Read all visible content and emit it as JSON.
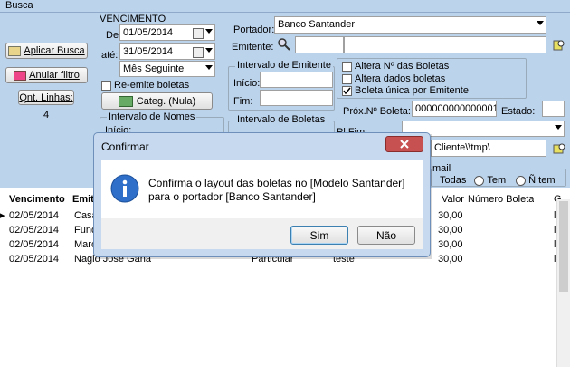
{
  "busca": {
    "title": "Busca"
  },
  "left": {
    "aplicar": "Aplicar Busca",
    "anular": "Anular filtro",
    "qnt_label": "Qnt. Linhas:",
    "qnt_value": "4"
  },
  "vencimento": {
    "title": "VENCIMENTO",
    "de_label": "De:",
    "de_value": "01/05/2014",
    "ate_label": "até:",
    "ate_value": "31/05/2014",
    "period": "Mês Seguinte",
    "reemite": "Re-emite boletas",
    "categ": "Categ. (Nula)",
    "nomes_group": "Intervalo de Nomes",
    "inicio_label": "Início:"
  },
  "portador": {
    "label": "Portador:",
    "value": "Banco Santander",
    "emitente_label": "Emitente:"
  },
  "intervalo_emitente": {
    "title": "Intervalo de Emitente",
    "inicio": "Início:",
    "fim": "Fim:"
  },
  "options": {
    "altera_num": "Altera Nº das Boletas",
    "altera_dados": "Altera dados boletas",
    "boleta_unica": "Boleta única por Emitente"
  },
  "intervalo_boletas": {
    "title": "Intervalo de Boletas"
  },
  "prox": {
    "label": "Próx.Nº Boleta:",
    "value": "000000000000001",
    "estado_label": "Estado:",
    "estado_value": ""
  },
  "pl_fim": "Pl.Fim:",
  "path": {
    "value": "Cliente\\\\tmp\\"
  },
  "email": {
    "title": "mail",
    "todas": "Todas",
    "tem": "Tem",
    "ntem": "Ñ tem"
  },
  "grid": {
    "headers": {
      "vencimento": "Vencimento",
      "emitente": "Emite",
      "valor": "Valor",
      "numero": "Número Boleta",
      "g": "G"
    },
    "rows": [
      {
        "vencimento": "02/05/2014",
        "emitente": "Casa",
        "valor": "30,00"
      },
      {
        "vencimento": "02/05/2014",
        "emitente": "Fund",
        "valor": "30,00"
      },
      {
        "vencimento": "02/05/2014",
        "emitente": "Marc",
        "valor": "30,00"
      },
      {
        "vencimento": "02/05/2014",
        "emitente": "Naglo Jose Gana",
        "tipo": "Particular",
        "extra": "teste",
        "valor": "30,00"
      }
    ]
  },
  "dialog": {
    "title": "Confirmar",
    "message_line1": "Confirma o layout das boletas no [Modelo Santander]",
    "message_line2": "para o portador [Banco Santander]",
    "sim": "Sim",
    "nao": "Não"
  }
}
